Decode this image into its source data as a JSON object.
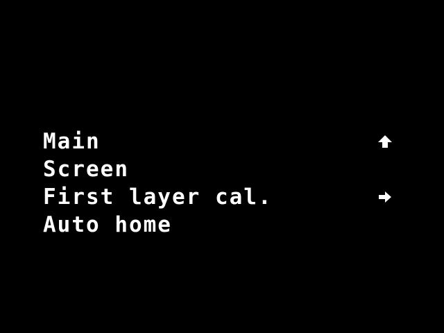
{
  "screen": {
    "background": "#000000",
    "foreground": "#ffffff"
  },
  "menu": {
    "items": [
      {
        "label": "Main",
        "icon": "up-arrow-icon"
      },
      {
        "label": "Screen",
        "icon": ""
      },
      {
        "label": "First layer cal.",
        "icon": "right-arrow-icon"
      },
      {
        "label": "Auto home",
        "icon": ""
      }
    ]
  }
}
